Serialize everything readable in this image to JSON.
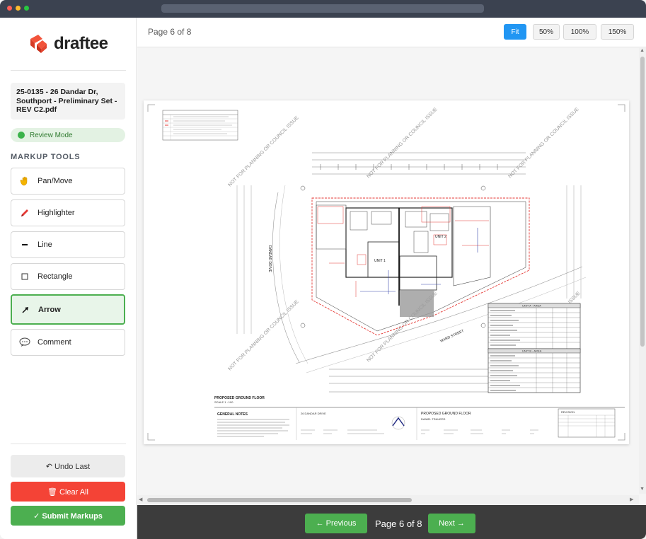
{
  "brand": {
    "name": "draftee"
  },
  "file": {
    "name": "25-0135 - 26 Dandar Dr, Southport - Preliminary Set - REV C2.pdf"
  },
  "mode": {
    "label": "Review Mode",
    "color": "#3bb34a"
  },
  "tools": {
    "title": "MARKUP TOOLS",
    "items": [
      {
        "label": "Pan/Move",
        "icon": "hand-icon",
        "active": false
      },
      {
        "label": "Highlighter",
        "icon": "highlighter-pen-icon",
        "active": false
      },
      {
        "label": "Line",
        "icon": "line-icon",
        "active": false
      },
      {
        "label": "Rectangle",
        "icon": "square-icon",
        "active": false
      },
      {
        "label": "Arrow",
        "icon": "arrow-icon",
        "active": true
      },
      {
        "label": "Comment",
        "icon": "speech-bubble-icon",
        "active": false
      }
    ]
  },
  "actions": {
    "undo": "↶ Undo Last",
    "clear": "🗑 Clear All",
    "submit": "✓ Submit Markups"
  },
  "toolbar": {
    "page_label": "Page 6 of 8",
    "zoom": [
      {
        "label": "Fit",
        "active": true
      },
      {
        "label": "50%",
        "active": false
      },
      {
        "label": "100%",
        "active": false
      },
      {
        "label": "150%",
        "active": false
      }
    ]
  },
  "drawing": {
    "watermark": "NOT FOR PLANNING OR COUNCIL ISSUE",
    "street_left": "DANDAR DRIVE",
    "street_bottom": "WARD STREET",
    "unit1": "UNIT 1",
    "unit2": "UNIT 2",
    "plan_title": "PROPOSED GROUND FLOOR",
    "scale": "SCALE 1 : 100",
    "notes_title": "GENERAL NOTES",
    "address": "26 DANDAR DRIVE",
    "sheet_title": "PROPOSED GROUND FLOOR",
    "client": "DANIEL TRAUERS",
    "table_a": "UNIT A - AREA",
    "table_b": "UNIT B - AREA",
    "revision": "REVISION"
  },
  "pagination": {
    "prev": "← Previous",
    "label": "Page 6 of 8",
    "next": "Next →"
  },
  "colors": {
    "accent": "#4caf50",
    "danger": "#f44336",
    "zoom_active": "#2196f3"
  }
}
